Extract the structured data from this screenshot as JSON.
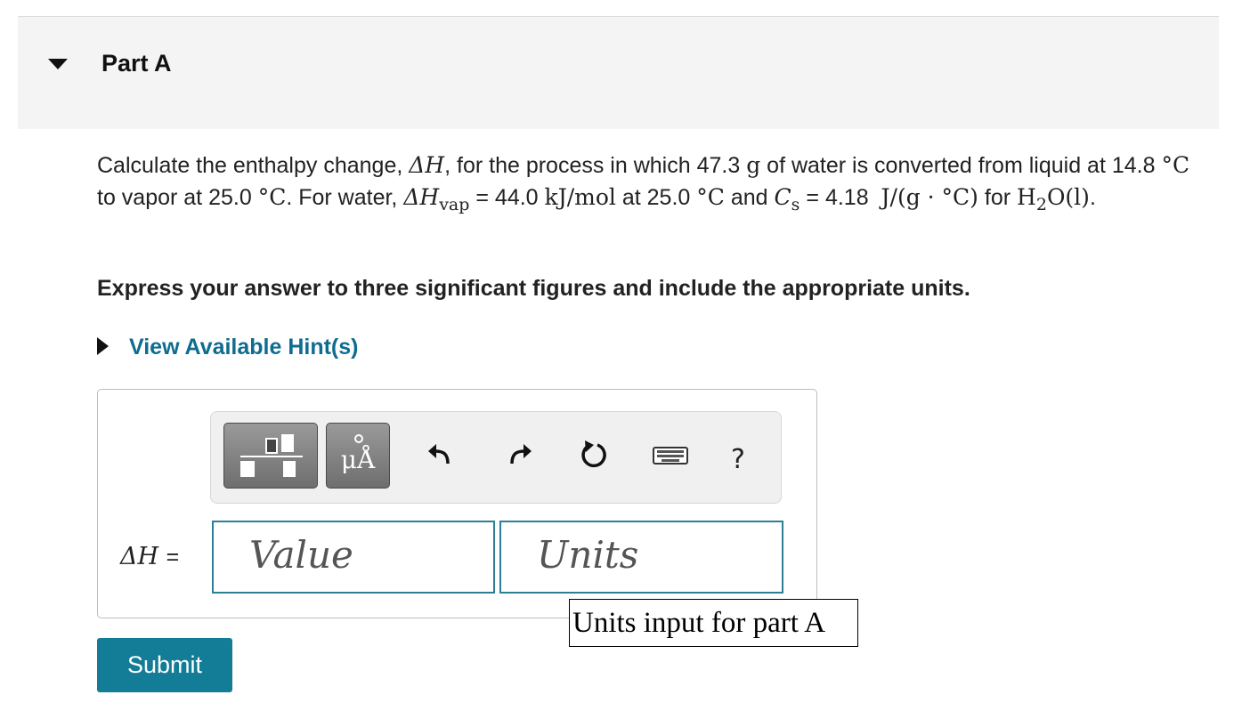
{
  "part": {
    "title": "Part A"
  },
  "question": {
    "s1": "Calculate the enthalpy change, ",
    "delta_h": "ΔH",
    "s2": ", for the process in which ",
    "mass": "47.3",
    "mass_unit": "g",
    "s3": " of water is converted from liquid at ",
    "t1": "14.8",
    "deg_c": "°C",
    "s4": " to vapor at ",
    "t2": "25.0",
    "s5": ". For water, ",
    "dhvap_base": "ΔH",
    "dhvap_sub": "vap",
    "s6": " = ",
    "dhvap_value": "44.0",
    "dhvap_unit": "kJ/mol",
    "s7": " at ",
    "t3": "25.0",
    "s8": " and ",
    "cs_base": "C",
    "cs_sub": "s",
    "s9": " = ",
    "cs_value": "4.18",
    "cs_unit": "J/(g · °C)",
    "s10": " for ",
    "water_formula_a": "H",
    "water_formula_sub": "2",
    "water_formula_b": "O(l)",
    "s11": "."
  },
  "instructions": "Express your answer to three significant figures and include the appropriate units.",
  "hint": {
    "label": "View Available Hint(s)"
  },
  "toolbar": {
    "symbols_label": "μÅ",
    "help_label": "?"
  },
  "answer": {
    "variable": "ΔH",
    "equals": "=",
    "value_placeholder": "Value",
    "units_placeholder": "Units",
    "units_tooltip": "Units input for part A"
  },
  "submit_label": "Submit",
  "colors": {
    "accent": "#137c96",
    "field_border": "#2c7f95",
    "hint_link": "#0e6d8f"
  }
}
